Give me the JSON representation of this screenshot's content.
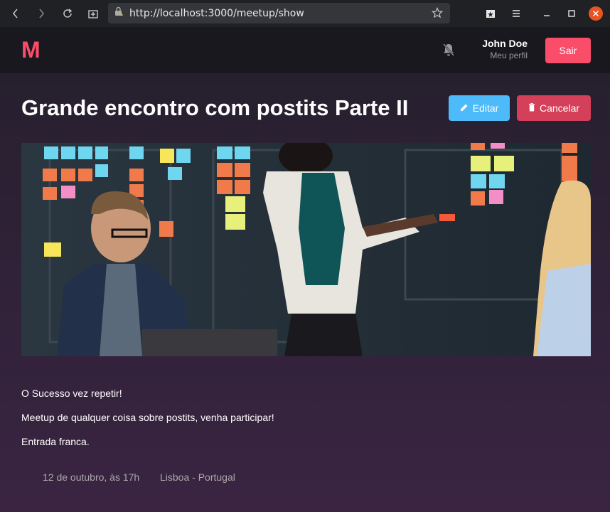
{
  "browser": {
    "url": "http://localhost:3000/meetup/show"
  },
  "header": {
    "logo": "M",
    "user_name": "John Doe",
    "user_profile": "Meu perfil",
    "logout_label": "Sair"
  },
  "meetup": {
    "title": "Grande encontro com postits Parte II",
    "edit_label": "Editar",
    "cancel_label": "Cancelar",
    "description": [
      "O Sucesso vez repetir!",
      "Meetup de qualquer coisa sobre postits, venha participar!",
      "Entrada franca."
    ],
    "date": "12 de outubro, às 17h",
    "location": "Lisboa - Portugal"
  },
  "colors": {
    "accent": "#f94d6a",
    "edit": "#4dbaf9",
    "header_bg": "#19181f"
  }
}
